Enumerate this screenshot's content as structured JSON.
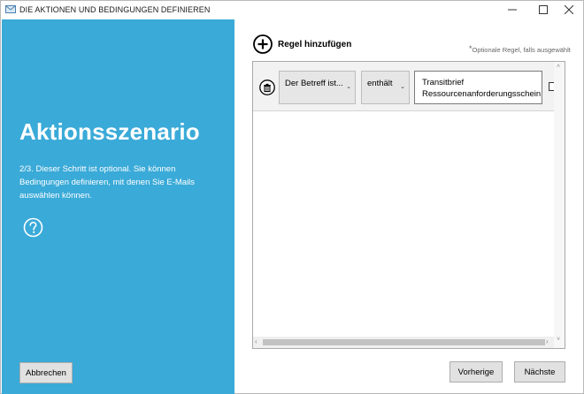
{
  "window": {
    "title": "DIE AKTIONEN UND BEDINGUNGEN DEFINIEREN",
    "controls": {
      "minimize": "—",
      "maximize": "☐",
      "close": "✕"
    }
  },
  "left_panel": {
    "heading": "Aktionsszenario",
    "description": "2/3. Dieser Schritt ist optional. Sie können Bedingungen definieren, mit denen Sie E-Mails auswählen können.",
    "help_icon": "question-circle-icon",
    "cancel_label": "Abbrechen",
    "background_color": "#3aaad8"
  },
  "rules": {
    "add_label": "Regel hinzufügen",
    "optional_note_star": "*",
    "optional_note": "Optionale Regel, falls ausgewählt",
    "items": [
      {
        "field": "Der Betreff ist...",
        "operator": "enthält",
        "value_line1": "Transitbrief",
        "value_line2": "Ressourcenanforderungsschein"
      }
    ]
  },
  "scrollbars": {
    "left_arrow": "‹",
    "right_arrow": "›",
    "up_arrow": "˄",
    "down_arrow": "˅",
    "dropdown_arrow": "⌄"
  },
  "footer": {
    "previous_label": "Vorherige",
    "next_label": "Nächste"
  }
}
